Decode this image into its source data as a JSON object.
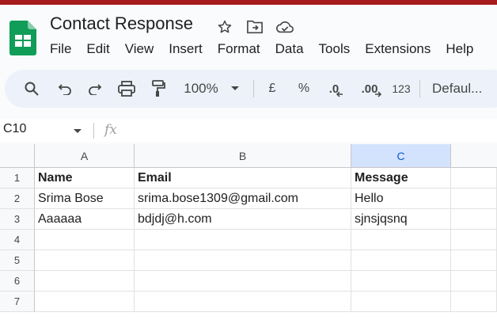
{
  "doc": {
    "title": "Contact Response"
  },
  "menu": [
    "File",
    "Edit",
    "View",
    "Insert",
    "Format",
    "Data",
    "Tools",
    "Extensions",
    "Help"
  ],
  "toolbar": {
    "zoom": "100%",
    "currency": "£",
    "percent": "%",
    "dec_decrease": ".0",
    "dec_increase": ".00",
    "number_format": "123",
    "font": "Defaul..."
  },
  "formula_bar": {
    "cell_ref": "C10",
    "fx": "fx"
  },
  "grid": {
    "columns": [
      "A",
      "B",
      "C"
    ],
    "selected_column": "C",
    "row_numbers": [
      "1",
      "2",
      "3",
      "4",
      "5",
      "6",
      "7"
    ],
    "rows": [
      [
        "Name",
        "Email",
        "Message"
      ],
      [
        "Srima Bose",
        "srima.bose1309@gmail.com",
        "Hello"
      ],
      [
        "Aaaaaa",
        "bdjdj@h.com",
        "sjnsjqsnq"
      ],
      [
        "",
        "",
        ""
      ],
      [
        "",
        "",
        ""
      ],
      [
        "",
        "",
        ""
      ],
      [
        "",
        "",
        ""
      ]
    ]
  },
  "colors": {
    "accent": "#0b57d0",
    "sheets_green": "#0f9d58",
    "toolbar_bg": "#edf2fa"
  }
}
